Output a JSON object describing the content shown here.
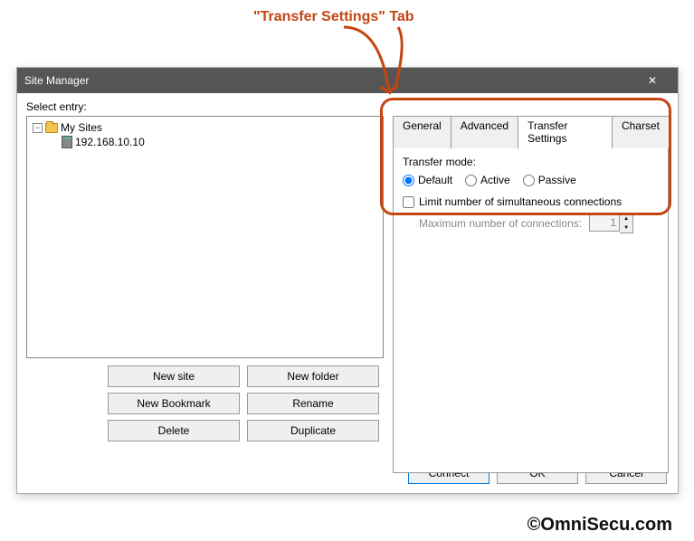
{
  "annotation": {
    "label": "\"Transfer Settings\" Tab"
  },
  "dialog": {
    "title": "Site Manager",
    "select_entry_label": "Select entry:"
  },
  "tree": {
    "root_label": "My Sites",
    "items": [
      {
        "label": "192.168.10.10"
      }
    ]
  },
  "buttons": {
    "new_site": "New site",
    "new_folder": "New folder",
    "new_bookmark": "New Bookmark",
    "rename": "Rename",
    "delete": "Delete",
    "duplicate": "Duplicate"
  },
  "tabs": {
    "general": "General",
    "advanced": "Advanced",
    "transfer_settings": "Transfer Settings",
    "charset": "Charset"
  },
  "transfer": {
    "mode_label": "Transfer mode:",
    "default": "Default",
    "active": "Active",
    "passive": "Passive",
    "limit_label": "Limit number of simultaneous connections",
    "max_label": "Maximum number of connections:",
    "max_value": "1"
  },
  "footer": {
    "connect": "Connect",
    "ok": "OK",
    "cancel": "Cancel"
  },
  "watermark": "OmniSecu.com",
  "copyright": "©OmniSecu.com"
}
